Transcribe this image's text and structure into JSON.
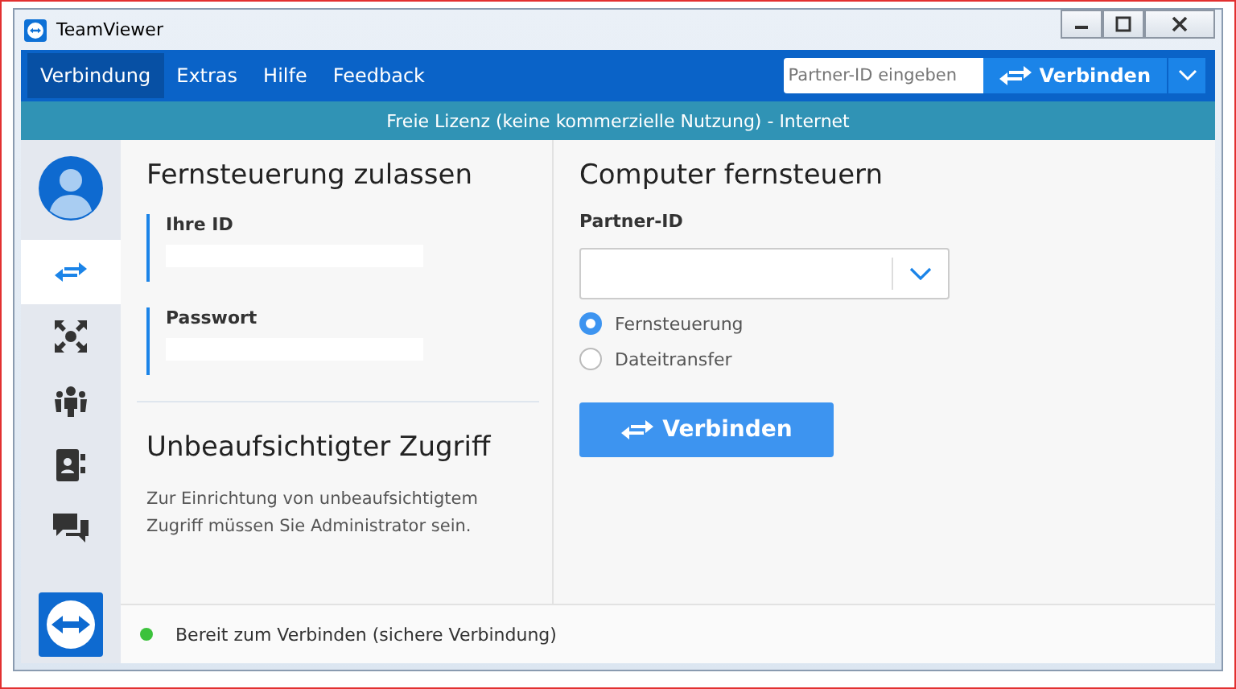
{
  "window": {
    "title": "TeamViewer"
  },
  "menu": [
    {
      "label": "Verbindung",
      "selected": true
    },
    {
      "label": "Extras",
      "selected": false
    },
    {
      "label": "Hilfe",
      "selected": false
    },
    {
      "label": "Feedback",
      "selected": false
    }
  ],
  "quick_connect": {
    "placeholder": "Partner-ID eingeben",
    "button": "Verbinden"
  },
  "license_bar": "Freie Lizenz (keine kommerzielle Nutzung) - Internet",
  "sidebar": {
    "items": [
      {
        "kind": "remote",
        "selected": true
      },
      {
        "kind": "meeting",
        "selected": false
      },
      {
        "kind": "contacts",
        "selected": false
      },
      {
        "kind": "addressbook",
        "selected": false
      },
      {
        "kind": "chat",
        "selected": false
      }
    ]
  },
  "allow_remote": {
    "title": "Fernsteuerung zulassen",
    "fields": [
      {
        "label": "Ihre ID"
      },
      {
        "label": "Passwort"
      }
    ]
  },
  "unattended": {
    "title": "Unbeaufsichtigter Zugriff",
    "text": "Zur Einrichtung von unbeaufsichtigtem Zugriff müssen Sie Administrator sein."
  },
  "remote_control": {
    "title": "Computer fernsteuern",
    "partner_label": "Partner-ID",
    "modes": [
      {
        "label": "Fernsteuerung",
        "selected": true
      },
      {
        "label": "Dateitransfer",
        "selected": false
      }
    ],
    "button": "Verbinden"
  },
  "status": {
    "text": "Bereit zum Verbinden (sichere Verbindung)",
    "color": "#3cc23c"
  }
}
